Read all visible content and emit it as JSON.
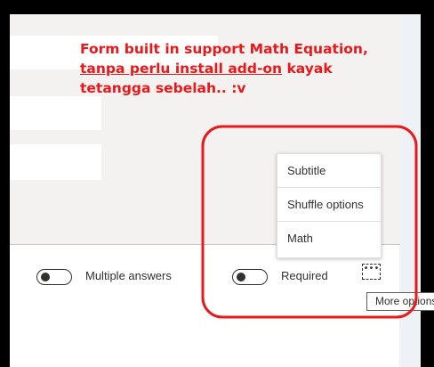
{
  "annotation": {
    "line1": "Form built in support Math Equation,",
    "line2_underlined": "tanpa perlu install add-on",
    "line2_rest": " kayak",
    "line3": "tetangga sebelah.. :v",
    "color": "#e8181b"
  },
  "more_menu": {
    "items": [
      {
        "label": "Subtitle"
      },
      {
        "label": "Shuffle options"
      },
      {
        "label": "Math"
      }
    ]
  },
  "question_footer": {
    "multiple_answers_label": "Multiple answers",
    "required_label": "Required",
    "more_button_glyph": "•••",
    "more_button_icon": "ellipsis-icon",
    "tooltip": "More options"
  },
  "colors": {
    "highlight": "#e8181b",
    "text": "#323130",
    "form_background": "#f3f2f1"
  }
}
